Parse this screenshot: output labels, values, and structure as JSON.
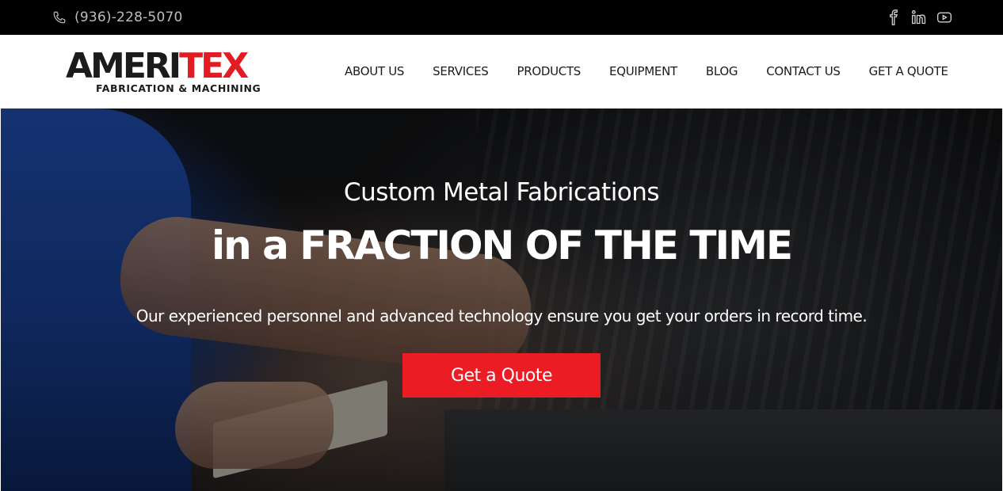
{
  "topbar": {
    "phone": "(936)-228-5070",
    "phone_icon": "phone-icon",
    "socials": [
      {
        "name": "facebook",
        "icon": "facebook-icon"
      },
      {
        "name": "linkedin",
        "icon": "linkedin-icon"
      },
      {
        "name": "youtube",
        "icon": "youtube-icon"
      }
    ]
  },
  "header": {
    "logo": {
      "text_dark": "AMERI",
      "text_red": "TEX",
      "tagline": "FABRICATION & MACHINING"
    },
    "nav": [
      {
        "label": "ABOUT US"
      },
      {
        "label": "SERVICES"
      },
      {
        "label": "PRODUCTS"
      },
      {
        "label": "EQUIPMENT"
      },
      {
        "label": "BLOG"
      },
      {
        "label": "CONTACT US"
      },
      {
        "label": "GET A QUOTE"
      }
    ]
  },
  "hero": {
    "subtitle": "Custom Metal Fabrications",
    "title": "in a FRACTION OF THE TIME",
    "description": "Our experienced personnel and advanced technology ensure you get your orders in record time.",
    "cta_label": "Get a Quote"
  },
  "colors": {
    "accent_red": "#ec1c24",
    "topbar_bg": "#000000",
    "logo_dark": "#1b1b1b",
    "logo_red": "#e31c23"
  }
}
